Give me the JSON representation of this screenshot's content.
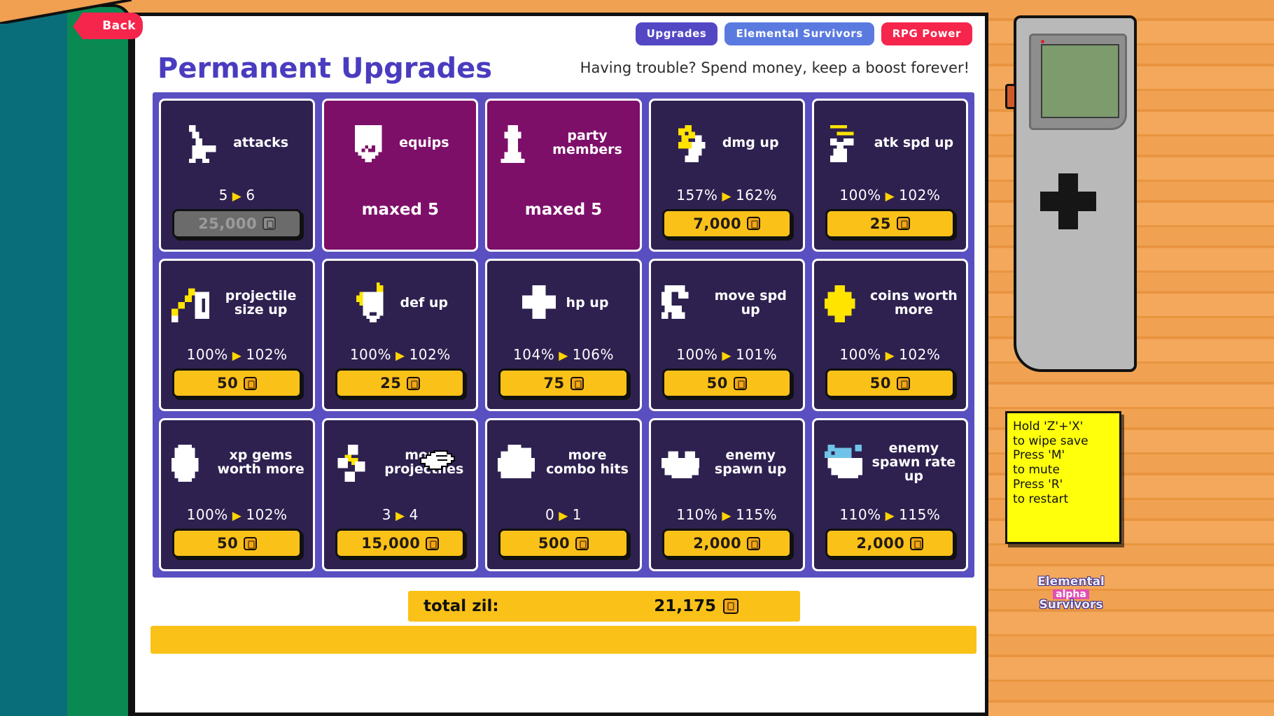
{
  "sidebar": {
    "back_label": "Back"
  },
  "topnav": {
    "buttons": [
      {
        "label": "Upgrades",
        "color": "#5447c4"
      },
      {
        "label": "Elemental Survivors",
        "color": "#5b7ae0"
      },
      {
        "label": "RPG Power",
        "color": "#f5254c"
      }
    ]
  },
  "header": {
    "title": "Permanent Upgrades",
    "subtitle": "Having trouble? Spend money, keep a boost forever!",
    "title_color": "#4a3cbf"
  },
  "upgrades": [
    {
      "name": "attacks",
      "icon": "sword-icon",
      "maxed": false,
      "from": "5",
      "to": "6",
      "price": "25,000",
      "affordable": false
    },
    {
      "name": "equips",
      "icon": "shield-icon",
      "maxed": true,
      "maxed_text": "maxed 5"
    },
    {
      "name": "party members",
      "icon": "person-icon",
      "maxed": true,
      "maxed_text": "maxed 5"
    },
    {
      "name": "dmg up",
      "icon": "sword-sparkle-icon",
      "maxed": false,
      "from": "157%",
      "to": "162%",
      "price": "7,000",
      "affordable": true
    },
    {
      "name": "atk spd up",
      "icon": "fast-sword-icon",
      "maxed": false,
      "from": "100%",
      "to": "102%",
      "price": "25",
      "affordable": true
    },
    {
      "name": "projectile size up",
      "icon": "projectile-size-icon",
      "maxed": false,
      "from": "100%",
      "to": "102%",
      "price": "50",
      "affordable": true
    },
    {
      "name": "def up",
      "icon": "shield-sparkle-icon",
      "maxed": false,
      "from": "100%",
      "to": "102%",
      "price": "25",
      "affordable": true
    },
    {
      "name": "hp up",
      "icon": "cross-icon",
      "maxed": false,
      "from": "104%",
      "to": "106%",
      "price": "75",
      "affordable": true
    },
    {
      "name": "move spd up",
      "icon": "boot-icon",
      "maxed": false,
      "from": "100%",
      "to": "101%",
      "price": "50",
      "affordable": true
    },
    {
      "name": "coins worth more",
      "icon": "coin-burst-icon",
      "maxed": false,
      "from": "100%",
      "to": "102%",
      "price": "50",
      "affordable": true
    },
    {
      "name": "xp gems worth more",
      "icon": "gem-icon",
      "maxed": false,
      "from": "100%",
      "to": "102%",
      "price": "50",
      "affordable": true
    },
    {
      "name": "more projectiles",
      "icon": "multi-projectile-icon",
      "maxed": false,
      "from": "3",
      "to": "4",
      "price": "15,000",
      "affordable": true
    },
    {
      "name": "more combo hits",
      "icon": "combo-fist-icon",
      "maxed": false,
      "from": "0",
      "to": "1",
      "price": "500",
      "affordable": true
    },
    {
      "name": "enemy spawn up",
      "icon": "enemy-icon",
      "maxed": false,
      "from": "110%",
      "to": "115%",
      "price": "2,000",
      "affordable": true
    },
    {
      "name": "enemy spawn rate up",
      "icon": "enemy-fast-icon",
      "maxed": false,
      "from": "110%",
      "to": "115%",
      "price": "2,000",
      "affordable": true
    }
  ],
  "totals": {
    "label": "total zil:",
    "value": "21,175"
  },
  "note": {
    "lines": [
      "Hold 'Z'+'X'",
      "to wipe save",
      "Press 'M'",
      "to mute",
      "Press 'R'",
      "to restart"
    ]
  },
  "logo": {
    "line1": "Elemental",
    "badge": "alpha",
    "line2": "Survivors"
  },
  "colors": {
    "card_bg": "#2e2150",
    "card_maxed_bg": "#7d0f69",
    "grid_bg": "#5a4fc0",
    "buy_bg": "#fac219",
    "arrow": "#ffd400"
  }
}
